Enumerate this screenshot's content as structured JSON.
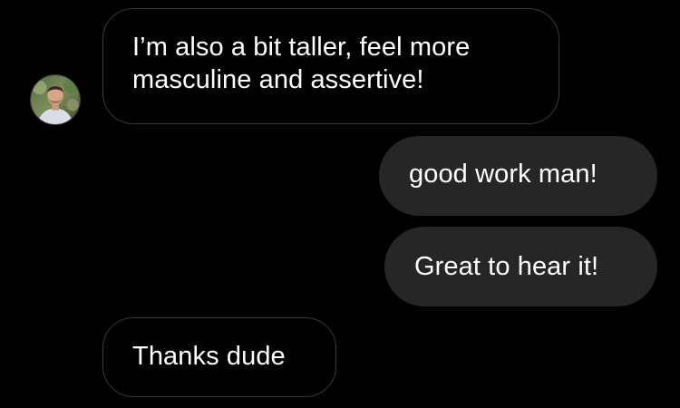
{
  "conversation": {
    "messages": [
      {
        "side": "received",
        "lines": [
          "I’m also a bit taller, feel more",
          "masculine and assertive!"
        ]
      },
      {
        "side": "sent",
        "text": "good work man!"
      },
      {
        "side": "sent",
        "text": "Great to hear it!"
      },
      {
        "side": "received",
        "text": "Thanks dude"
      }
    ]
  },
  "colors": {
    "background": "#000000",
    "sent_bubble": "#262626",
    "received_border": "#3a3a3c",
    "text": "#ffffff"
  },
  "avatar": {
    "icon": "contact-avatar-photo"
  }
}
